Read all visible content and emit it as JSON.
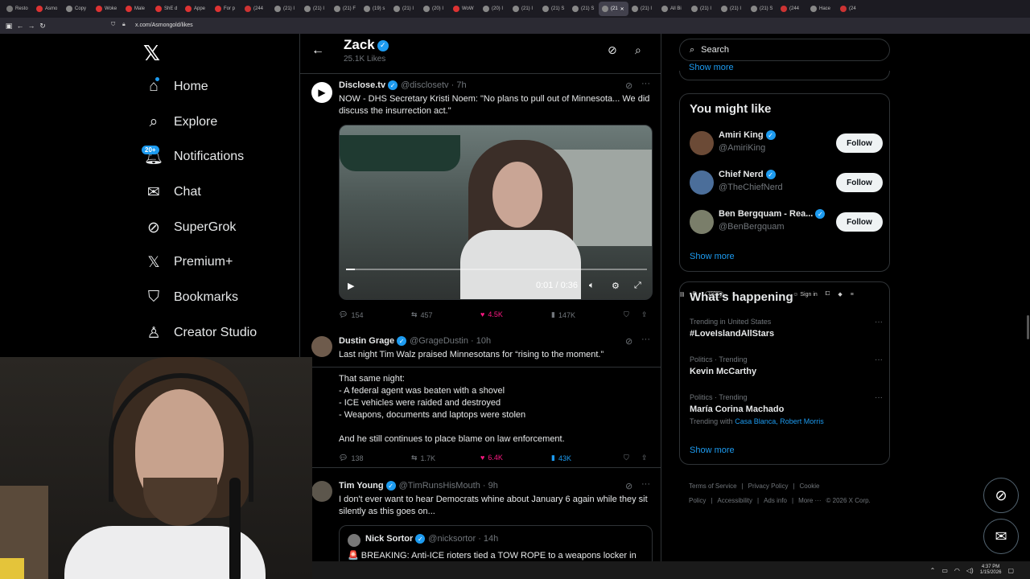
{
  "browser": {
    "tabs": [
      {
        "label": "Resto",
        "color": "#777777"
      },
      {
        "label": "Asmo",
        "color": "#d33"
      },
      {
        "label": "Copy",
        "color": "#888888"
      },
      {
        "label": "Woke",
        "color": "#d33"
      },
      {
        "label": "Male",
        "color": "#d33"
      },
      {
        "label": "ShE d",
        "color": "#d33"
      },
      {
        "label": "Appe",
        "color": "#d33"
      },
      {
        "label": "For p",
        "color": "#d33"
      },
      {
        "label": "(244",
        "color": "#c33"
      },
      {
        "label": "(21) I",
        "color": "#888888"
      },
      {
        "label": "(21) I",
        "color": "#888888"
      },
      {
        "label": "(21) F",
        "color": "#888888"
      },
      {
        "label": "(19) s",
        "color": "#888888"
      },
      {
        "label": "(21) I",
        "color": "#888888"
      },
      {
        "label": "(20) I",
        "color": "#888888"
      },
      {
        "label": "WoW",
        "color": "#d33"
      },
      {
        "label": "(20) I",
        "color": "#888888"
      },
      {
        "label": "(21) I",
        "color": "#888888"
      },
      {
        "label": "(21) S",
        "color": "#888888"
      },
      {
        "label": "(21) S",
        "color": "#888888"
      },
      {
        "label": "(21",
        "color": "#888888",
        "active": true
      },
      {
        "label": "(21) I",
        "color": "#888888"
      },
      {
        "label": "All Bi",
        "color": "#888888"
      },
      {
        "label": "(21) I",
        "color": "#888888"
      },
      {
        "label": "(21) I",
        "color": "#888888"
      },
      {
        "label": "(21) S",
        "color": "#888888"
      },
      {
        "label": "(244",
        "color": "#c33"
      },
      {
        "label": "Hace",
        "color": "#888888"
      },
      {
        "label": "(24",
        "color": "#c33"
      }
    ],
    "url": "x.com/Asmongold/likes",
    "zoom": "150%",
    "sign_in": "Sign in"
  },
  "nav": {
    "items": [
      {
        "label": "Home",
        "icon": "home-icon"
      },
      {
        "label": "Explore",
        "icon": "search-icon"
      },
      {
        "label": "Notifications",
        "icon": "bell-icon"
      },
      {
        "label": "Chat",
        "icon": "mail-icon"
      },
      {
        "label": "SuperGrok",
        "icon": "grok-icon"
      },
      {
        "label": "Premium+",
        "icon": "x-icon"
      },
      {
        "label": "Bookmarks",
        "icon": "bookmark-icon"
      },
      {
        "label": "Creator Studio",
        "icon": "creator-icon"
      }
    ],
    "notif_badge": "20+"
  },
  "header": {
    "title": "Zack",
    "subtitle": "25.1K Likes"
  },
  "posts": [
    {
      "name": "Disclose.tv",
      "handle": "@disclosetv · 7h",
      "text": "NOW - DHS Secretary Kristi Noem: \"No plans to pull out of Minnesota... We did discuss the insurrection act.\"",
      "video_time": "0:01 / 0:36",
      "video_progress": 0.03,
      "replies": "154",
      "reposts": "457",
      "likes": "4.5K",
      "views": "147K"
    },
    {
      "name": "Dustin Grage",
      "handle": "@GrageDustin · 10h",
      "text": "Last night Tim Walz praised Minnesotans for “rising to the moment.”\n\nThat same night:\n- A federal agent was beaten with a shovel\n- ICE vehicles were raided and destroyed\n- Weapons, documents and laptops were stolen\n\nAnd he still continues to place blame on law enforcement.",
      "replies": "138",
      "reposts": "1.7K",
      "likes": "6.4K",
      "views": "43K"
    },
    {
      "name": "Tim Young",
      "handle": "@TimRunsHisMouth · 9h",
      "text": "I don't ever want to hear Democrats whine about January 6 again while they sit silently as this goes on...",
      "quote": {
        "name": "Nick Sortor",
        "handle": "@nicksortor · 14h",
        "text": "🚨 BREAKING: Anti-ICE rioters tied a TOW ROPE to a weapons locker in"
      }
    }
  ],
  "sidebar": {
    "search_placeholder": "Search",
    "show_more": "Show more",
    "wtf_title": "You might like",
    "wtf": [
      {
        "name": "Amiri King",
        "handle": "@AmiriKing",
        "button": "Follow",
        "color": "#6b4a36"
      },
      {
        "name": "Chief Nerd",
        "handle": "@TheChiefNerd",
        "button": "Follow",
        "color": "#4b6e9a"
      },
      {
        "name": "Ben Bergquam - Rea...",
        "handle": "@BenBergquam",
        "button": "Follow",
        "color": "#7a7e6a"
      }
    ],
    "trends_title": "What’s happening",
    "trends": [
      {
        "context": "Trending in United States",
        "title": "#LoveIslandAllStars"
      },
      {
        "context": "Politics · Trending",
        "title": "Kevin McCarthy"
      },
      {
        "context": "Politics · Trending",
        "title": "María Corina Machado",
        "with_label": "Trending with",
        "with": "Casa Blanca, Robert Morris"
      }
    ],
    "footer": [
      "Terms of Service",
      "|",
      "Privacy Policy",
      "|",
      "Cookie Policy",
      "|",
      "Accessibility",
      "|",
      "Ads info",
      "|",
      "More ···",
      "© 2026 X Corp."
    ]
  },
  "taskbar": {
    "time": "4:37 PM",
    "date": "1/15/2026"
  }
}
